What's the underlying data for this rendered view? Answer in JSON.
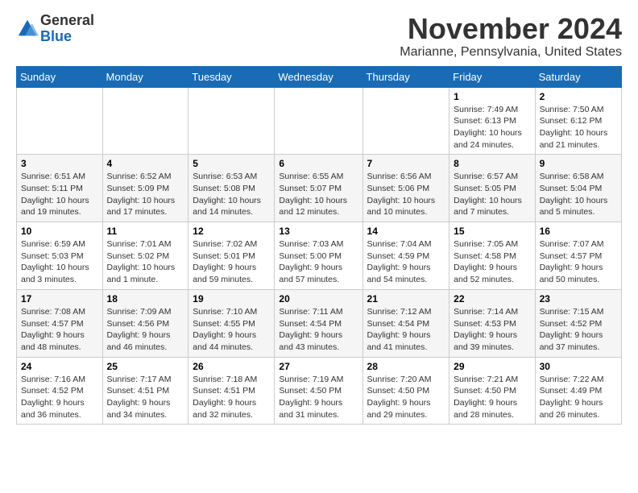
{
  "header": {
    "logo_line1": "General",
    "logo_line2": "Blue",
    "month_title": "November 2024",
    "location": "Marianne, Pennsylvania, United States"
  },
  "days_of_week": [
    "Sunday",
    "Monday",
    "Tuesday",
    "Wednesday",
    "Thursday",
    "Friday",
    "Saturday"
  ],
  "weeks": [
    [
      {
        "day": "",
        "info": ""
      },
      {
        "day": "",
        "info": ""
      },
      {
        "day": "",
        "info": ""
      },
      {
        "day": "",
        "info": ""
      },
      {
        "day": "",
        "info": ""
      },
      {
        "day": "1",
        "info": "Sunrise: 7:49 AM\nSunset: 6:13 PM\nDaylight: 10 hours\nand 24 minutes."
      },
      {
        "day": "2",
        "info": "Sunrise: 7:50 AM\nSunset: 6:12 PM\nDaylight: 10 hours\nand 21 minutes."
      }
    ],
    [
      {
        "day": "3",
        "info": "Sunrise: 6:51 AM\nSunset: 5:11 PM\nDaylight: 10 hours\nand 19 minutes."
      },
      {
        "day": "4",
        "info": "Sunrise: 6:52 AM\nSunset: 5:09 PM\nDaylight: 10 hours\nand 17 minutes."
      },
      {
        "day": "5",
        "info": "Sunrise: 6:53 AM\nSunset: 5:08 PM\nDaylight: 10 hours\nand 14 minutes."
      },
      {
        "day": "6",
        "info": "Sunrise: 6:55 AM\nSunset: 5:07 PM\nDaylight: 10 hours\nand 12 minutes."
      },
      {
        "day": "7",
        "info": "Sunrise: 6:56 AM\nSunset: 5:06 PM\nDaylight: 10 hours\nand 10 minutes."
      },
      {
        "day": "8",
        "info": "Sunrise: 6:57 AM\nSunset: 5:05 PM\nDaylight: 10 hours\nand 7 minutes."
      },
      {
        "day": "9",
        "info": "Sunrise: 6:58 AM\nSunset: 5:04 PM\nDaylight: 10 hours\nand 5 minutes."
      }
    ],
    [
      {
        "day": "10",
        "info": "Sunrise: 6:59 AM\nSunset: 5:03 PM\nDaylight: 10 hours\nand 3 minutes."
      },
      {
        "day": "11",
        "info": "Sunrise: 7:01 AM\nSunset: 5:02 PM\nDaylight: 10 hours\nand 1 minute."
      },
      {
        "day": "12",
        "info": "Sunrise: 7:02 AM\nSunset: 5:01 PM\nDaylight: 9 hours\nand 59 minutes."
      },
      {
        "day": "13",
        "info": "Sunrise: 7:03 AM\nSunset: 5:00 PM\nDaylight: 9 hours\nand 57 minutes."
      },
      {
        "day": "14",
        "info": "Sunrise: 7:04 AM\nSunset: 4:59 PM\nDaylight: 9 hours\nand 54 minutes."
      },
      {
        "day": "15",
        "info": "Sunrise: 7:05 AM\nSunset: 4:58 PM\nDaylight: 9 hours\nand 52 minutes."
      },
      {
        "day": "16",
        "info": "Sunrise: 7:07 AM\nSunset: 4:57 PM\nDaylight: 9 hours\nand 50 minutes."
      }
    ],
    [
      {
        "day": "17",
        "info": "Sunrise: 7:08 AM\nSunset: 4:57 PM\nDaylight: 9 hours\nand 48 minutes."
      },
      {
        "day": "18",
        "info": "Sunrise: 7:09 AM\nSunset: 4:56 PM\nDaylight: 9 hours\nand 46 minutes."
      },
      {
        "day": "19",
        "info": "Sunrise: 7:10 AM\nSunset: 4:55 PM\nDaylight: 9 hours\nand 44 minutes."
      },
      {
        "day": "20",
        "info": "Sunrise: 7:11 AM\nSunset: 4:54 PM\nDaylight: 9 hours\nand 43 minutes."
      },
      {
        "day": "21",
        "info": "Sunrise: 7:12 AM\nSunset: 4:54 PM\nDaylight: 9 hours\nand 41 minutes."
      },
      {
        "day": "22",
        "info": "Sunrise: 7:14 AM\nSunset: 4:53 PM\nDaylight: 9 hours\nand 39 minutes."
      },
      {
        "day": "23",
        "info": "Sunrise: 7:15 AM\nSunset: 4:52 PM\nDaylight: 9 hours\nand 37 minutes."
      }
    ],
    [
      {
        "day": "24",
        "info": "Sunrise: 7:16 AM\nSunset: 4:52 PM\nDaylight: 9 hours\nand 36 minutes."
      },
      {
        "day": "25",
        "info": "Sunrise: 7:17 AM\nSunset: 4:51 PM\nDaylight: 9 hours\nand 34 minutes."
      },
      {
        "day": "26",
        "info": "Sunrise: 7:18 AM\nSunset: 4:51 PM\nDaylight: 9 hours\nand 32 minutes."
      },
      {
        "day": "27",
        "info": "Sunrise: 7:19 AM\nSunset: 4:50 PM\nDaylight: 9 hours\nand 31 minutes."
      },
      {
        "day": "28",
        "info": "Sunrise: 7:20 AM\nSunset: 4:50 PM\nDaylight: 9 hours\nand 29 minutes."
      },
      {
        "day": "29",
        "info": "Sunrise: 7:21 AM\nSunset: 4:50 PM\nDaylight: 9 hours\nand 28 minutes."
      },
      {
        "day": "30",
        "info": "Sunrise: 7:22 AM\nSunset: 4:49 PM\nDaylight: 9 hours\nand 26 minutes."
      }
    ]
  ]
}
